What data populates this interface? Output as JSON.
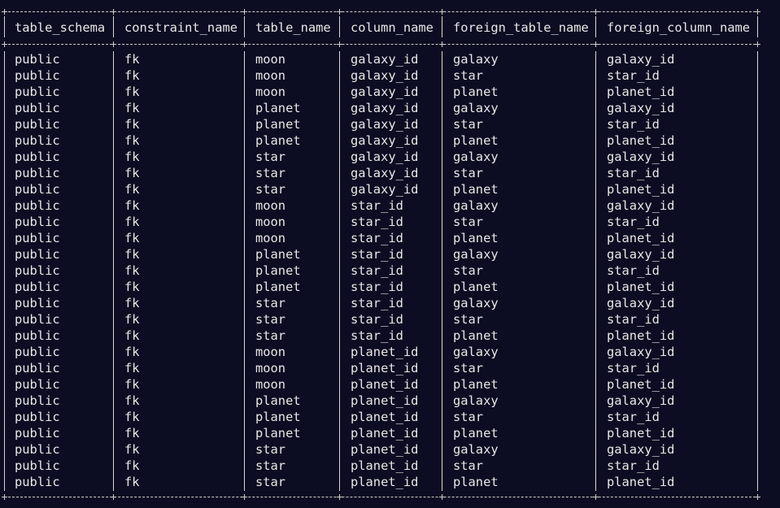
{
  "table": {
    "columns": [
      "table_schema",
      "constraint_name",
      "table_name",
      "column_name",
      "foreign_table_name",
      "foreign_column_name"
    ],
    "rows": [
      [
        "public",
        "fk",
        "moon",
        "galaxy_id",
        "galaxy",
        "galaxy_id"
      ],
      [
        "public",
        "fk",
        "moon",
        "galaxy_id",
        "star",
        "star_id"
      ],
      [
        "public",
        "fk",
        "moon",
        "galaxy_id",
        "planet",
        "planet_id"
      ],
      [
        "public",
        "fk",
        "planet",
        "galaxy_id",
        "galaxy",
        "galaxy_id"
      ],
      [
        "public",
        "fk",
        "planet",
        "galaxy_id",
        "star",
        "star_id"
      ],
      [
        "public",
        "fk",
        "planet",
        "galaxy_id",
        "planet",
        "planet_id"
      ],
      [
        "public",
        "fk",
        "star",
        "galaxy_id",
        "galaxy",
        "galaxy_id"
      ],
      [
        "public",
        "fk",
        "star",
        "galaxy_id",
        "star",
        "star_id"
      ],
      [
        "public",
        "fk",
        "star",
        "galaxy_id",
        "planet",
        "planet_id"
      ],
      [
        "public",
        "fk",
        "moon",
        "star_id",
        "galaxy",
        "galaxy_id"
      ],
      [
        "public",
        "fk",
        "moon",
        "star_id",
        "star",
        "star_id"
      ],
      [
        "public",
        "fk",
        "moon",
        "star_id",
        "planet",
        "planet_id"
      ],
      [
        "public",
        "fk",
        "planet",
        "star_id",
        "galaxy",
        "galaxy_id"
      ],
      [
        "public",
        "fk",
        "planet",
        "star_id",
        "star",
        "star_id"
      ],
      [
        "public",
        "fk",
        "planet",
        "star_id",
        "planet",
        "planet_id"
      ],
      [
        "public",
        "fk",
        "star",
        "star_id",
        "galaxy",
        "galaxy_id"
      ],
      [
        "public",
        "fk",
        "star",
        "star_id",
        "star",
        "star_id"
      ],
      [
        "public",
        "fk",
        "star",
        "star_id",
        "planet",
        "planet_id"
      ],
      [
        "public",
        "fk",
        "moon",
        "planet_id",
        "galaxy",
        "galaxy_id"
      ],
      [
        "public",
        "fk",
        "moon",
        "planet_id",
        "star",
        "star_id"
      ],
      [
        "public",
        "fk",
        "moon",
        "planet_id",
        "planet",
        "planet_id"
      ],
      [
        "public",
        "fk",
        "planet",
        "planet_id",
        "galaxy",
        "galaxy_id"
      ],
      [
        "public",
        "fk",
        "planet",
        "planet_id",
        "star",
        "star_id"
      ],
      [
        "public",
        "fk",
        "planet",
        "planet_id",
        "planet",
        "planet_id"
      ],
      [
        "public",
        "fk",
        "star",
        "planet_id",
        "galaxy",
        "galaxy_id"
      ],
      [
        "public",
        "fk",
        "star",
        "planet_id",
        "star",
        "star_id"
      ],
      [
        "public",
        "fk",
        "star",
        "planet_id",
        "planet",
        "planet_id"
      ]
    ]
  },
  "colors": {
    "background": "#0c0c22",
    "text": "#e8e8e8",
    "border": "#cfcfcf"
  }
}
